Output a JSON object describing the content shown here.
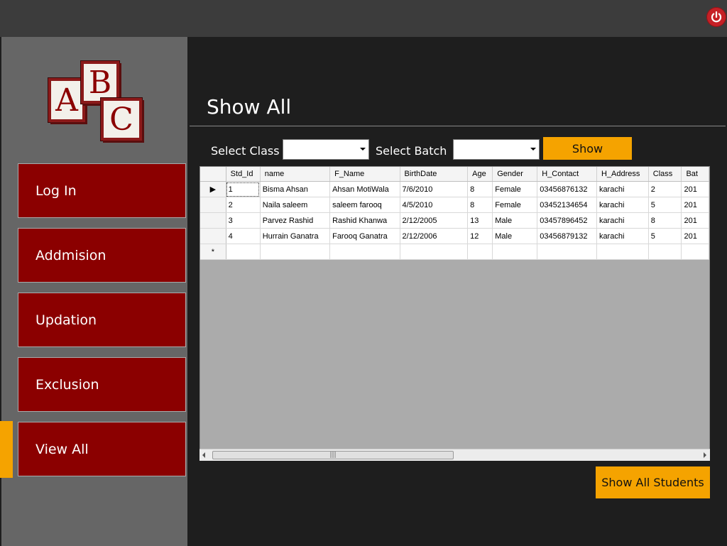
{
  "topbar": {
    "power_icon": "power-icon"
  },
  "logo": {
    "letters": [
      "A",
      "B",
      "C"
    ]
  },
  "nav": {
    "items": [
      {
        "label": "Log In"
      },
      {
        "label": "Addmision"
      },
      {
        "label": "Updation"
      },
      {
        "label": "Exclusion"
      },
      {
        "label": "View All"
      }
    ],
    "active_index": 4
  },
  "page": {
    "title": "Show All"
  },
  "filters": {
    "class_label": "Select Class",
    "class_value": "",
    "batch_label": "Select Batch",
    "batch_value": "",
    "show_button": "Show"
  },
  "grid": {
    "columns": [
      "Std_Id",
      "name",
      "F_Name",
      "BirthDate",
      "Age",
      "Gender",
      "H_Contact",
      "H_Address",
      "Class",
      "Bat"
    ],
    "rows": [
      [
        "1",
        "Bisma Ahsan",
        "Ahsan MotiWala",
        "7/6/2010",
        "8",
        "Female",
        "03456876132",
        "karachi",
        "2",
        "201"
      ],
      [
        "2",
        "Naila saleem",
        "saleem farooq",
        "4/5/2010",
        "8",
        "Female",
        "03452134654",
        "karachi",
        "5",
        "201"
      ],
      [
        "3",
        "Parvez Rashid",
        "Rashid Khanwa",
        "2/12/2005",
        "13",
        "Male",
        "03457896452",
        "karachi",
        "8",
        "201"
      ],
      [
        "4",
        "Hurrain Ganatra",
        "Farooq Ganatra",
        "2/12/2006",
        "12",
        "Male",
        "03456879132",
        "karachi",
        "5",
        "201"
      ]
    ],
    "current_row_marker": "▶",
    "new_row_marker": "*"
  },
  "footer": {
    "show_all_button": "Show All Students"
  },
  "colors": {
    "accent": "#f5a300",
    "nav": "#8b0000",
    "sidebar": "#666666",
    "background": "#1e1e1e"
  }
}
